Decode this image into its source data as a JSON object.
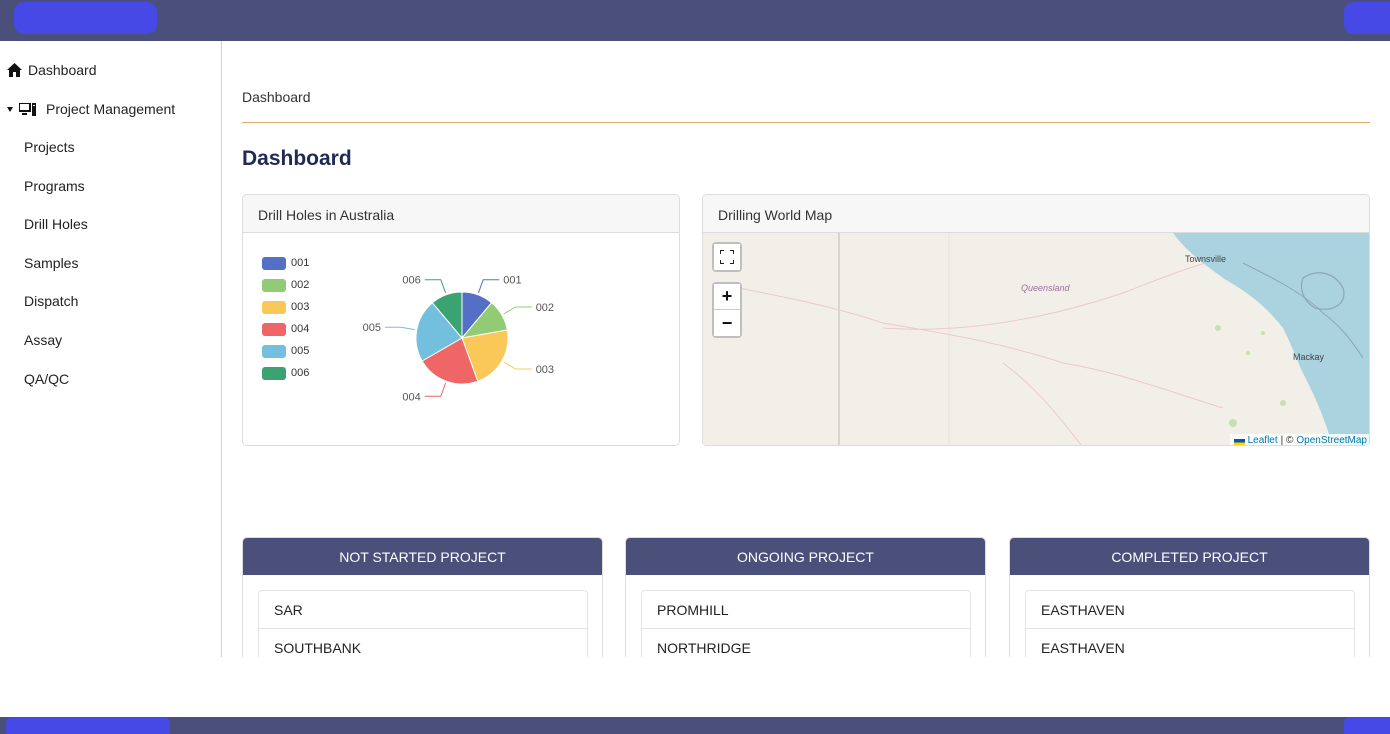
{
  "nav": {
    "dashboard": "Dashboard",
    "project_management": "Project Management",
    "sub_items": [
      "Projects",
      "Programs",
      "Drill Holes",
      "Samples",
      "Dispatch",
      "Assay",
      "QA/QC"
    ]
  },
  "breadcrumb": "Dashboard",
  "page_title": "Dashboard",
  "pie_card": {
    "title": "Drill Holes in Australia"
  },
  "map_card": {
    "title": "Drilling World Map",
    "labels": {
      "region": "Queensland",
      "city1": "Townsville",
      "city2": "Mackay"
    },
    "zoom_in": "+",
    "zoom_out": "−",
    "attribution": {
      "leaflet": "Leaflet",
      "sep": "| ©",
      "osm": "OpenStreetMap"
    }
  },
  "chart_data": {
    "type": "pie",
    "categories": [
      "001",
      "002",
      "003",
      "004",
      "005",
      "006"
    ],
    "values": [
      1,
      1,
      2,
      2,
      2,
      1
    ],
    "colors": [
      "#5470c6",
      "#91cc75",
      "#fac858",
      "#ee6666",
      "#73c0de",
      "#3ba272"
    ],
    "legend": "top-left"
  },
  "status": {
    "not_started": {
      "header": "NOT STARTED PROJECT",
      "items": [
        "SAR",
        "SOUTHBANK"
      ]
    },
    "ongoing": {
      "header": "ONGOING PROJECT",
      "items": [
        "PROMHILL",
        "NORTHRIDGE"
      ]
    },
    "completed": {
      "header": "COMPLETED PROJECT",
      "items": [
        "EASTHAVEN",
        "EASTHAVEN"
      ]
    }
  }
}
